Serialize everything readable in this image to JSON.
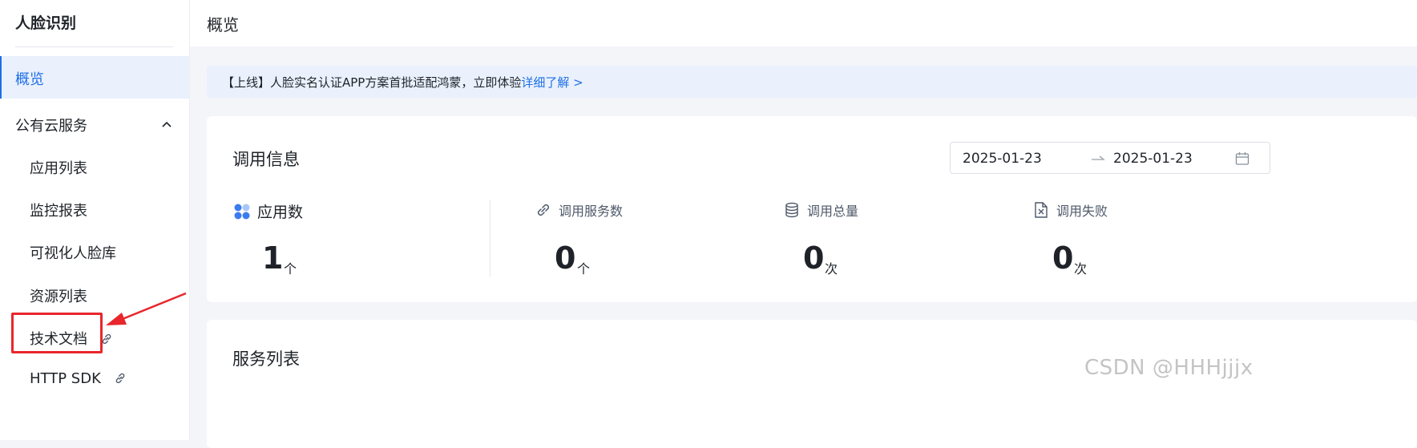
{
  "sidebar": {
    "title": "人脸识别",
    "active_item": "概览",
    "group": {
      "label": "公有云服务",
      "expanded": true
    },
    "items": [
      {
        "label": "应用列表"
      },
      {
        "label": "监控报表"
      },
      {
        "label": "可视化人脸库"
      },
      {
        "label": "资源列表"
      },
      {
        "label": "技术文档",
        "icon": "link-icon",
        "highlighted": true
      },
      {
        "label": "HTTP SDK",
        "icon": "link-icon"
      }
    ]
  },
  "header": {
    "title": "概览"
  },
  "notice": {
    "text": "【上线】人脸实名认证APP方案首批适配鸿蒙，立即体验",
    "link": "详细了解 >"
  },
  "call_info": {
    "title": "调用信息",
    "date_range": {
      "start": "2025-01-23",
      "end": "2025-01-23"
    },
    "stats": [
      {
        "label": "应用数",
        "value": "1",
        "unit": "个",
        "icon": "apps-icon"
      },
      {
        "label": "调用服务数",
        "value": "0",
        "unit": "个",
        "icon": "link-icon"
      },
      {
        "label": "调用总量",
        "value": "0",
        "unit": "次",
        "icon": "database-icon"
      },
      {
        "label": "调用失败",
        "value": "0",
        "unit": "次",
        "icon": "file-error-icon"
      }
    ]
  },
  "service_list": {
    "title": "服务列表"
  },
  "watermark": "CSDN @HHHjjjx",
  "colors": {
    "accent": "#1f6fe5",
    "annotation": "#e8262c"
  }
}
